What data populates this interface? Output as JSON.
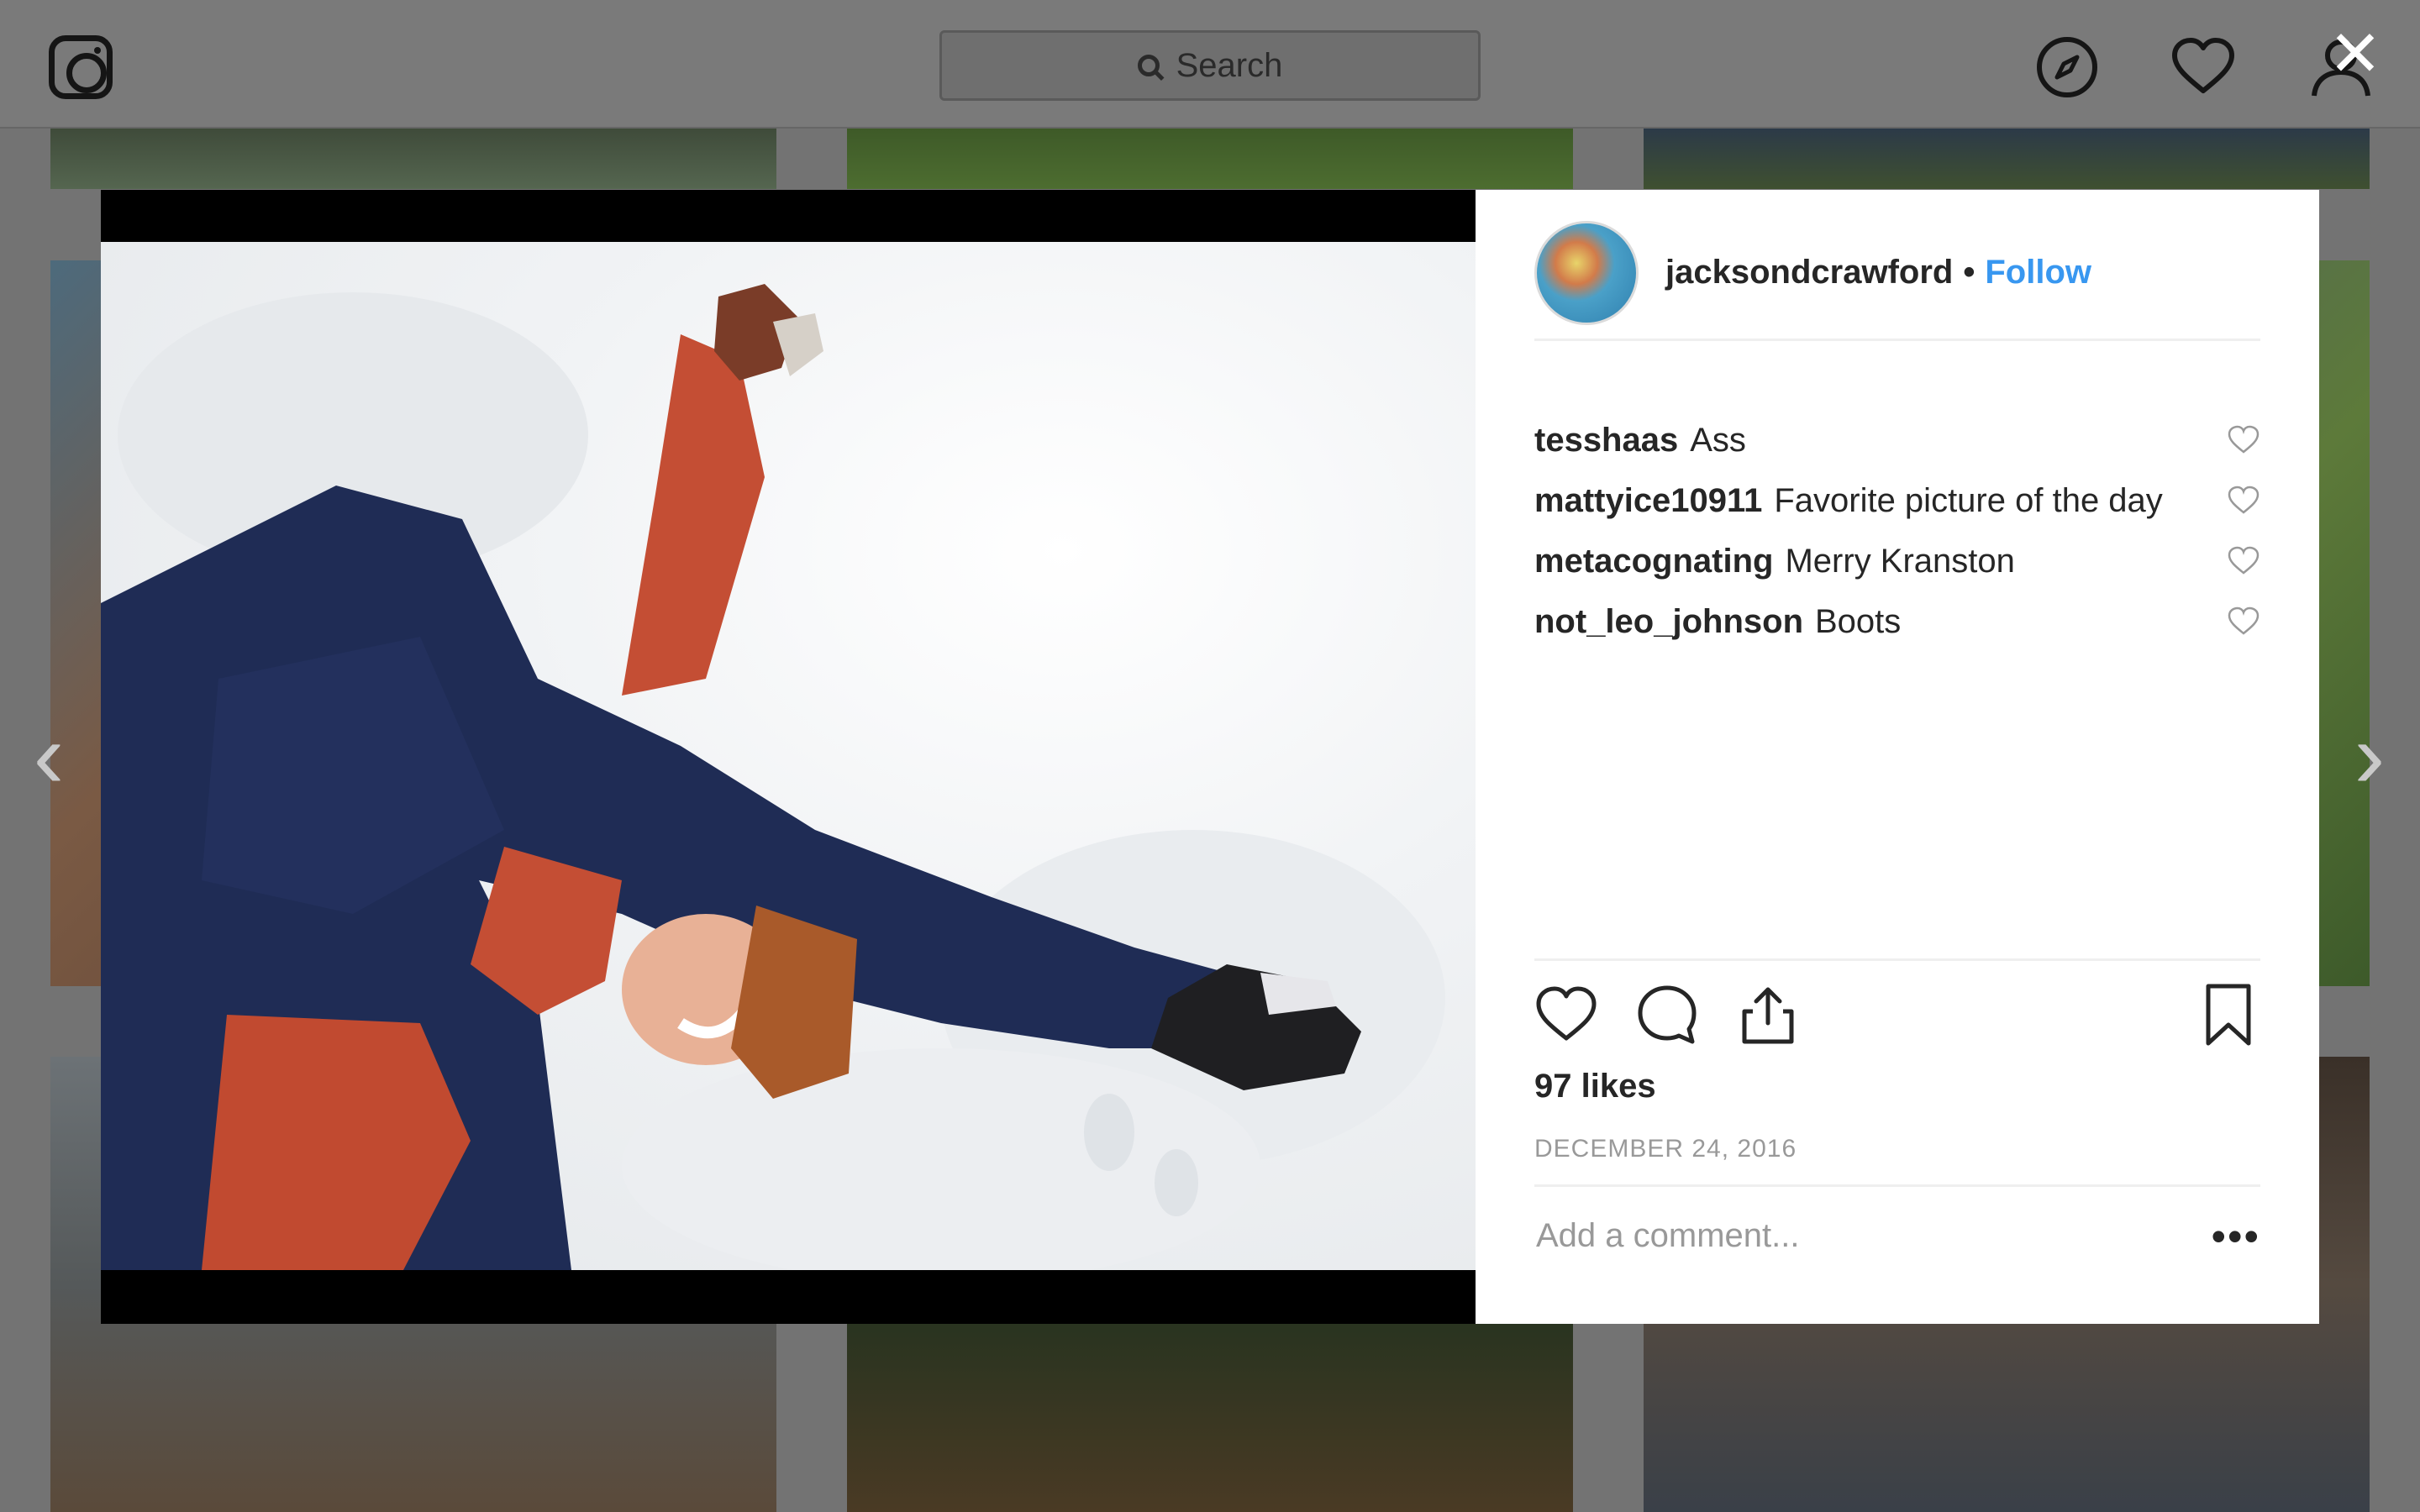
{
  "app": {
    "search_placeholder": "Search"
  },
  "nav": {
    "icons": [
      "instagram-logo-icon",
      "compass-icon",
      "heart-icon",
      "profile-icon",
      "close-icon"
    ]
  },
  "post": {
    "username": "jacksondcrawford",
    "separator": "•",
    "follow_label": "Follow",
    "comments": [
      {
        "user": "tesshaas",
        "text": "Ass"
      },
      {
        "user": "mattyice10911",
        "text": "Favorite picture of the day"
      },
      {
        "user": "metacognating",
        "text": "Merry Kranston"
      },
      {
        "user": "not_leo_johnson",
        "text": "Boots"
      }
    ],
    "likes": "97 likes",
    "date": "DECEMBER 24, 2016",
    "comment_placeholder": "Add a comment...",
    "more_label": "•••"
  },
  "colors": {
    "accent": "#3897f0",
    "text": "#262626",
    "muted": "#999999"
  }
}
